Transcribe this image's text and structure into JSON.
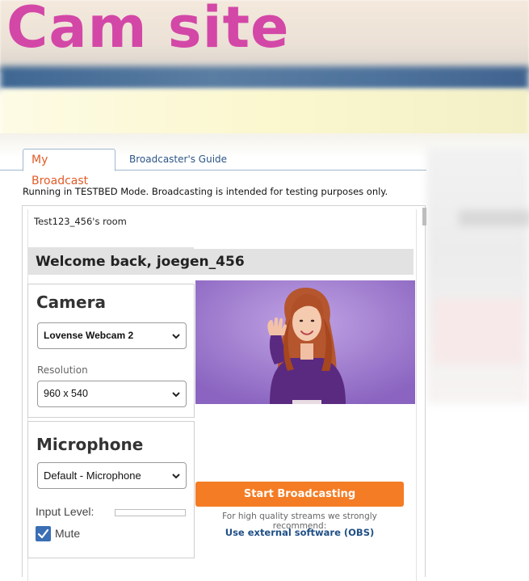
{
  "site": {
    "logo_text": "Cam site"
  },
  "tabs": [
    {
      "label": "My Broadcast",
      "active": true
    },
    {
      "label": "Broadcaster's Guide",
      "active": false
    }
  ],
  "notice": "Running in TESTBED Mode. Broadcasting is intended for testing purposes only.",
  "room": {
    "title": "Test123_456's room",
    "welcome": "Welcome back, joegen_456"
  },
  "camera": {
    "title": "Camera",
    "device_selected": "Lovense Webcam 2",
    "resolution_label": "Resolution",
    "resolution_selected": "960 x 540"
  },
  "microphone": {
    "title": "Microphone",
    "device_selected": "Default - Microphone",
    "input_level_label": "Input Level:",
    "input_level": 0,
    "mute_label": "Mute",
    "mute_checked": true
  },
  "broadcast": {
    "start_label": "Start Broadcasting",
    "recommend_text": "For high quality streams we strongly recommend:",
    "obs_link": "Use external software (OBS)"
  },
  "colors": {
    "accent_orange": "#f47c24",
    "logo_pink": "#d347a7",
    "link_blue": "#1f4f86",
    "active_tab": "#e05c28",
    "checkbox_blue": "#3b6fb5"
  },
  "icons": {
    "select_arrow": "chevron-down-icon",
    "mute_check": "checkmark-icon"
  }
}
